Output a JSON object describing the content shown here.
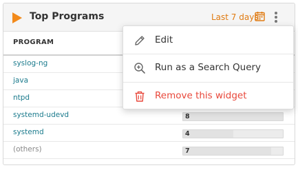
{
  "widget": {
    "title": "Top Programs",
    "range_label": "Last 7 days",
    "column_header": "PROGRAM",
    "rows": [
      {
        "name": "syslog-ng",
        "count": "",
        "muted": false
      },
      {
        "name": "java",
        "count": "",
        "muted": false
      },
      {
        "name": "ntpd",
        "count": "",
        "muted": false
      },
      {
        "name": "systemd-udevd",
        "count": "8",
        "muted": false
      },
      {
        "name": "systemd",
        "count": "4",
        "muted": false
      },
      {
        "name": "(others)",
        "count": "7",
        "muted": true
      }
    ]
  },
  "menu": {
    "items": [
      {
        "label": "Edit",
        "icon": "pencil-icon"
      },
      {
        "label": "Run as a Search Query",
        "icon": "zoom-in-icon"
      },
      {
        "label": "Remove this widget",
        "icon": "trash-icon"
      }
    ]
  },
  "colors": {
    "accent": "#f28a1b",
    "link": "#1a7a8c",
    "danger": "#e8473a"
  }
}
